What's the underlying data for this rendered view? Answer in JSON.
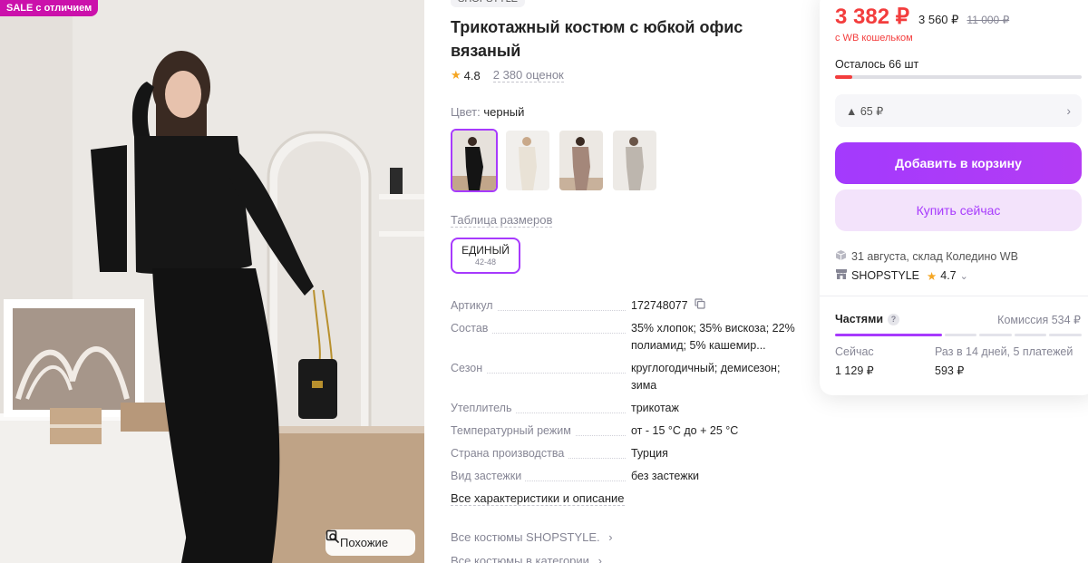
{
  "photo": {
    "badge": "SALE с отличием",
    "similar_label": "Похожие"
  },
  "product": {
    "brand_chip": "SHOPSTYLE",
    "title": "Трикотажный костюм с юбкой офис вязаный",
    "rating": "4.8",
    "reviews": "2 380 оценок",
    "color_label": "Цвет:",
    "color_value": "черный",
    "size_table": "Таблица размеров",
    "size": {
      "name": "ЕДИНЫЙ",
      "range": "42-48"
    },
    "specs": [
      {
        "key": "Артикул",
        "value": "172748077"
      },
      {
        "key": "Состав",
        "value": "35% хлопок; 35% вискоза; 22% полиамид; 5% кашемир..."
      },
      {
        "key": "Сезон",
        "value": "круглогодичный; демисезон; зима"
      },
      {
        "key": "Утеплитель",
        "value": "трикотаж"
      },
      {
        "key": "Температурный режим",
        "value": "от - 15 °C до + 25 °C"
      },
      {
        "key": "Страна производства",
        "value": "Турция"
      },
      {
        "key": "Вид застежки",
        "value": "без застежки"
      }
    ],
    "all_specs": "Все характеристики и описание",
    "links": [
      "Все костюмы SHOPSTYLE.",
      "Все костюмы в категории"
    ]
  },
  "buy": {
    "price": "3 382 ₽",
    "price_wallet": "3 560 ₽",
    "price_old": "11 000 ₽",
    "wallet_note": "с WB кошельком",
    "left": "Осталось 66 шт",
    "stock_fraction": 0.07,
    "discount": "▲ 65 ₽",
    "add_to_cart": "Добавить в корзину",
    "buy_now": "Купить сейчас",
    "delivery": "31 августа, склад Коледино WB",
    "seller": "SHOPSTYLE",
    "seller_rating": "4.7",
    "parts_label": "Частями",
    "parts_help": "?",
    "commission": "Комиссия 534 ₽",
    "plan_now_label": "Сейчас",
    "plan_now_amount": "1 129 ₽",
    "plan_later_label": "Раз в 14 дней, 5 платежей",
    "plan_later_amount": "593 ₽"
  },
  "colors": {
    "accent": "#a73afd",
    "price_red": "#f33d3d",
    "sale_badge": "#cb11ab"
  }
}
